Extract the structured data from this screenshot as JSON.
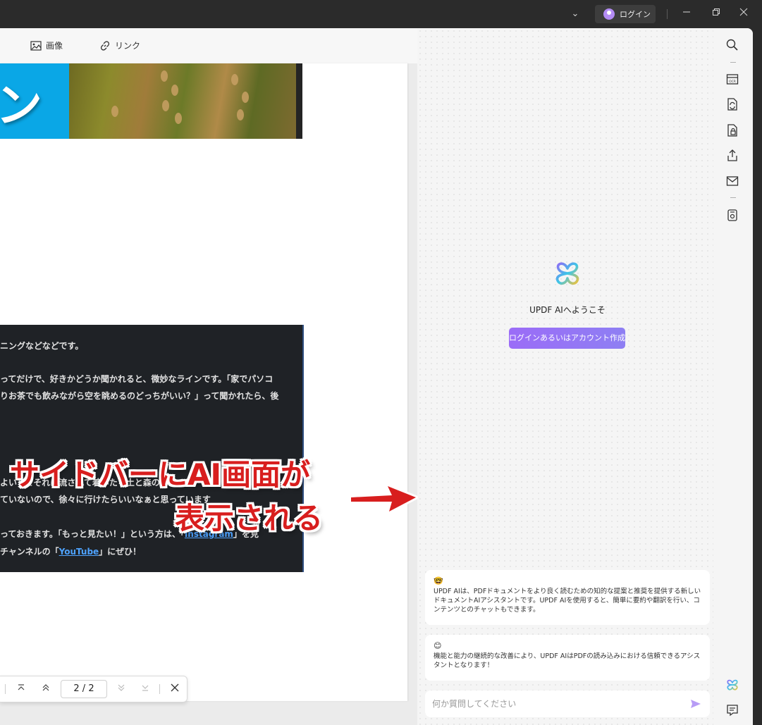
{
  "titlebar": {
    "login_label": "ログイン",
    "window_controls": [
      "minimize",
      "restore",
      "close"
    ]
  },
  "doc_toolbar": {
    "image_label": "画像",
    "link_label": "リンク"
  },
  "page": {
    "banner_char": "ン",
    "dark_lines": [
      "ニングなどなどです。",
      "ってだけで、好きかどうか聞かれると、微妙なラインです。「家でパソコ",
      "りお茶でも飲みながら空を眺めるのどっちがいい？」って聞かれたら、後",
      "よいしてそれに流されて着いたら土と森の",
      "ていないので、徐々に行けたらいいなぁと思っています",
      "っておきます。「もっと見たい！」という方は、「",
      "チャンネルの「"
    ],
    "link_instagram": "Instagram",
    "after_instagram": "」を見",
    "link_youtube": "YouTube",
    "after_youtube": "」にぜひ！"
  },
  "findbar": {
    "page_indicator": "2 / 2"
  },
  "ai": {
    "welcome": "UPDF AIへようこそ",
    "login_button": "ログインあるいはアカウント作成",
    "messages": [
      {
        "emoji": "🤓",
        "text": "UPDF AIは、PDFドキュメントをより良く読むための知的な提案と推奨を提供する新しいドキュメントAIアシスタントです。UPDF AIを使用すると、簡単に要約や翻訳を行い、コンテンツとのチャットもできます。"
      },
      {
        "emoji": "😊",
        "text": "機能と能力の継続的な改善により、UPDF AIはPDFの読み込みにおける信頼できるアシスタントとなります！"
      }
    ],
    "input_placeholder": "何か質問してください"
  },
  "annotation": {
    "line1": "サイドバーにAI画面が",
    "line2": "表示される"
  },
  "colors": {
    "accent": "#9b6cf7",
    "annotation_red": "#d81e1e",
    "link_blue": "#4ea3ff",
    "titlebar": "#2b2b2b"
  }
}
